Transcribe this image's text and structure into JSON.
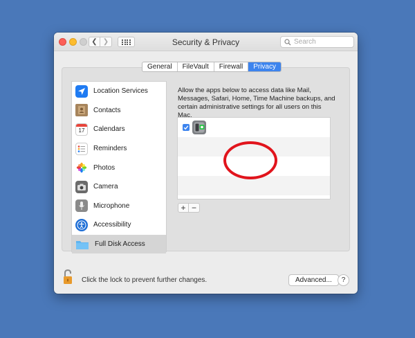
{
  "window": {
    "title": "Security & Privacy"
  },
  "search": {
    "placeholder": "Search"
  },
  "tabs": [
    {
      "label": "General",
      "active": false
    },
    {
      "label": "FileVault",
      "active": false
    },
    {
      "label": "Firewall",
      "active": false
    },
    {
      "label": "Privacy",
      "active": true
    }
  ],
  "sidebar": {
    "items": [
      {
        "label": "Location Services",
        "icon": "location-arrow-icon"
      },
      {
        "label": "Contacts",
        "icon": "contacts-book-icon"
      },
      {
        "label": "Calendars",
        "icon": "calendar-icon",
        "day": "17"
      },
      {
        "label": "Reminders",
        "icon": "reminders-list-icon"
      },
      {
        "label": "Photos",
        "icon": "photos-flower-icon"
      },
      {
        "label": "Camera",
        "icon": "camera-icon"
      },
      {
        "label": "Microphone",
        "icon": "microphone-icon"
      },
      {
        "label": "Accessibility",
        "icon": "accessibility-icon"
      },
      {
        "label": "Full Disk Access",
        "icon": "folder-icon",
        "selected": true
      }
    ]
  },
  "content": {
    "description": "Allow the apps below to access data like Mail, Messages, Safari, Home, Time Machine backups, and certain administrative settings for all users on this Mac.",
    "apps": [
      {
        "checked": true,
        "icon": "app-icon"
      }
    ],
    "add_label": "+",
    "remove_label": "−"
  },
  "footer": {
    "lock_text": "Click the lock to prevent further changes.",
    "advanced_label": "Advanced...",
    "help_label": "?"
  },
  "colors": {
    "desktop": "#4a78b9",
    "accent": "#3d84ee",
    "annotation_circle": "#e1141c"
  }
}
